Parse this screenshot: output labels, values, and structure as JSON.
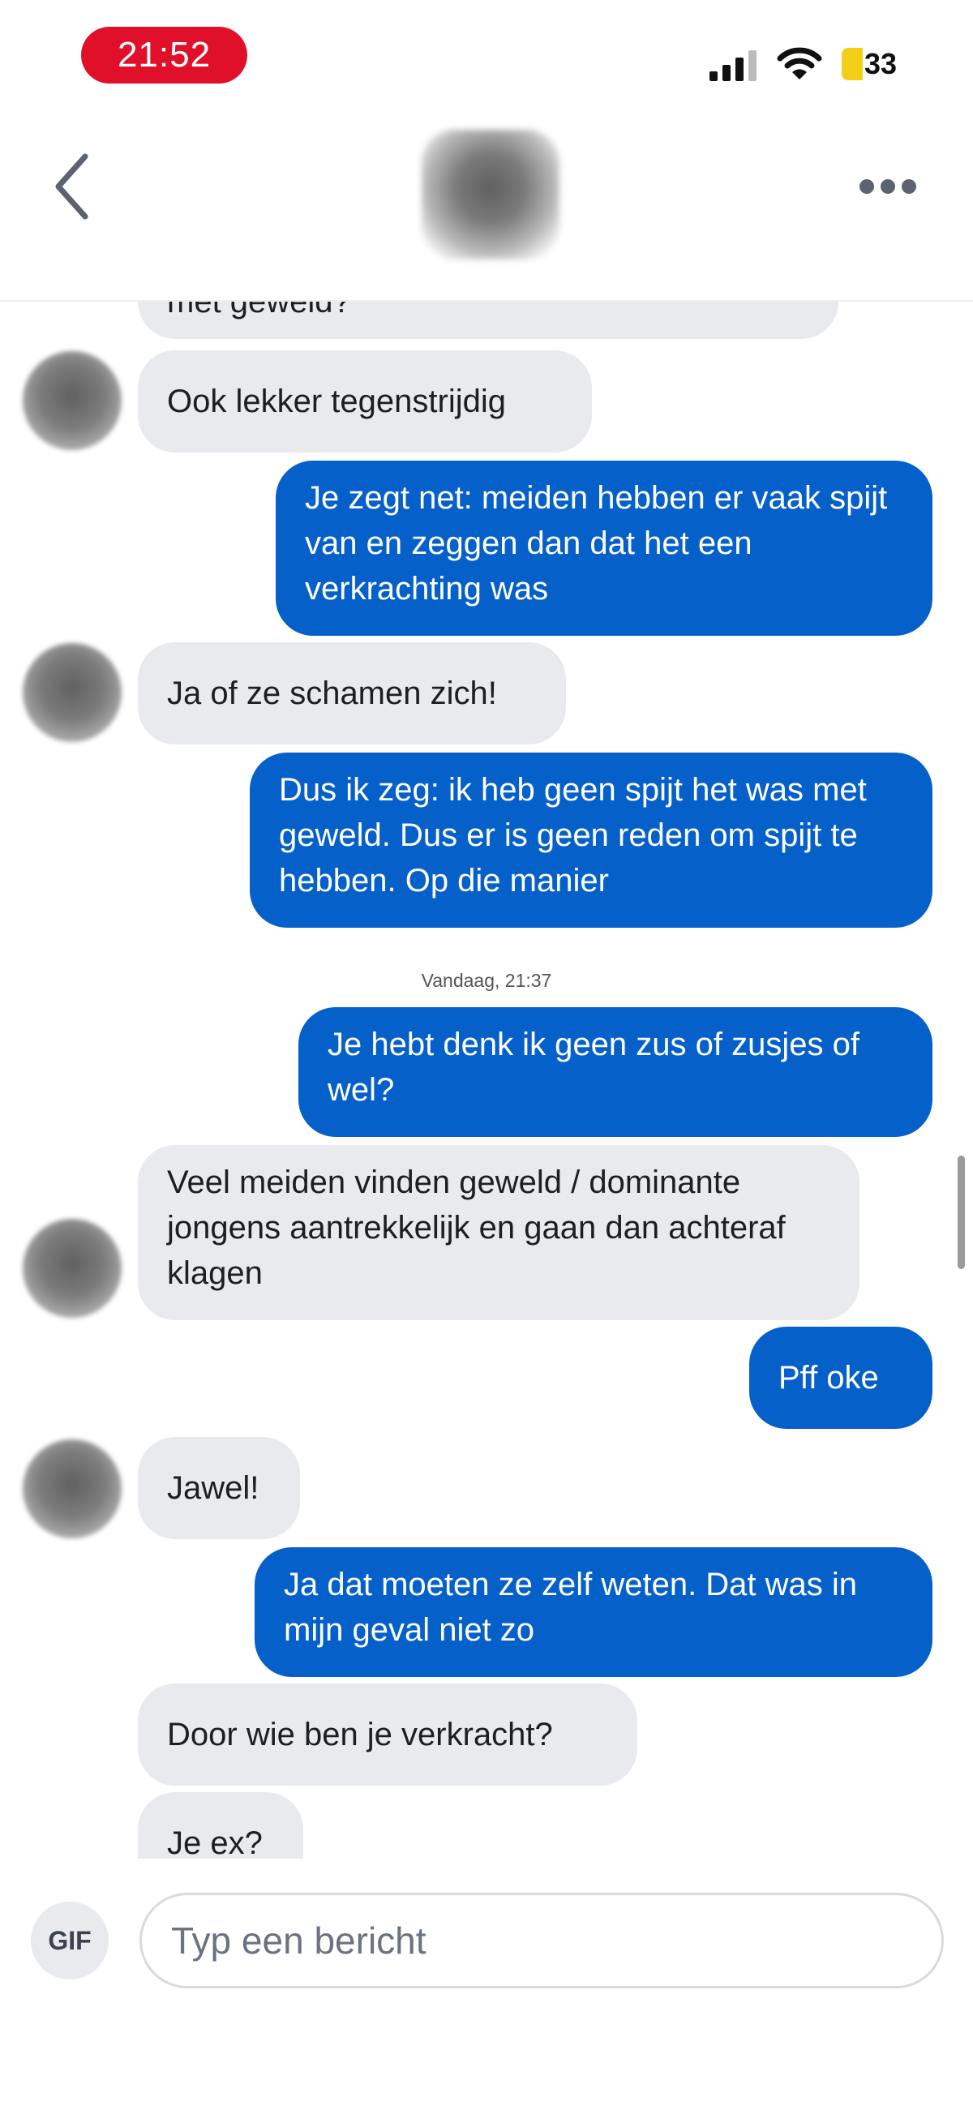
{
  "status_bar": {
    "time": "21:52",
    "battery": "33"
  },
  "header": {
    "back_icon": "chevron-left-icon",
    "more_icon": "ellipsis-icon"
  },
  "conversation": {
    "partial_top": "met geweld?",
    "messages": [
      {
        "dir": "in",
        "text": "Ook lekker tegenstrijdig"
      },
      {
        "dir": "out",
        "text": "Je zegt net: meiden hebben er vaak spijt van en zeggen dan dat het een verkrachting was"
      },
      {
        "dir": "in",
        "text": "Ja of ze schamen zich!"
      },
      {
        "dir": "out",
        "text": "Dus ik zeg: ik heb geen spijt het was met geweld. Dus er is geen reden om spijt te hebben. Op die manier"
      },
      {
        "dir": "out",
        "text": "Je hebt denk ik geen zus of zusjes of wel?"
      },
      {
        "dir": "in",
        "text": "Veel meiden vinden geweld / dominante jongens aantrekkelijk en gaan dan achteraf klagen"
      },
      {
        "dir": "out",
        "text": "Pff oke"
      },
      {
        "dir": "in",
        "text": "Jawel!"
      },
      {
        "dir": "out",
        "text": "Ja dat moeten ze zelf weten. Dat was in mijn geval niet zo"
      },
      {
        "dir": "in",
        "text": "Door wie ben je verkracht?"
      },
      {
        "dir": "in",
        "text": "Je ex?"
      }
    ],
    "timestamp": "Vandaag, 21:37"
  },
  "composer": {
    "gif_label": "GIF",
    "placeholder": "Typ een bericht"
  },
  "colors": {
    "outgoing": "#0560c9",
    "incoming": "#e8eaed",
    "time_pill": "#e0102a"
  }
}
